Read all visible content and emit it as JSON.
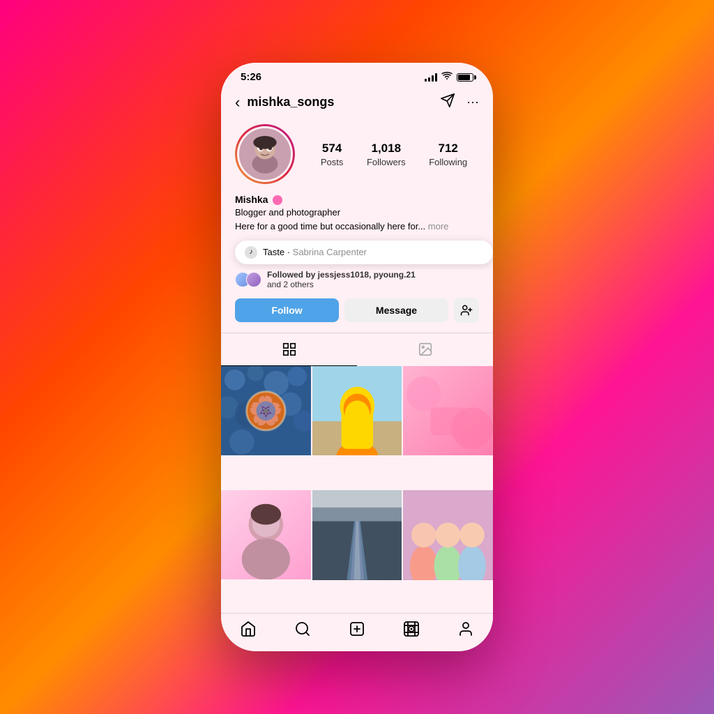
{
  "phone": {
    "status_time": "5:26",
    "background_gradient": "linear-gradient(135deg, #ff0080, #ff4500, #ff8c00, #ff1493, #9b59b6)"
  },
  "header": {
    "back_label": "‹",
    "username": "mishka_songs",
    "send_icon": "send",
    "more_icon": "more"
  },
  "profile": {
    "display_name": "Mishka",
    "verified": true,
    "bio_line1": "Blogger and photographer",
    "bio_line2": "Here for a good time but occasionally here for...",
    "bio_more": "more",
    "stats": {
      "posts_count": "574",
      "posts_label": "Posts",
      "followers_count": "1,018",
      "followers_label": "Followers",
      "following_count": "712",
      "following_label": "Following"
    }
  },
  "music": {
    "song": "Taste",
    "separator": "·",
    "artist": "Sabrina Carpenter"
  },
  "followed_by": {
    "text": "Followed by jessjess1018, pyoung.21",
    "text2": "and 2 others"
  },
  "buttons": {
    "follow": "Follow",
    "message": "Message",
    "add_friend_icon": "person-add"
  },
  "tabs": {
    "grid_icon": "grid",
    "tagged_icon": "person-tag"
  },
  "nav": {
    "home_icon": "home",
    "search_icon": "search",
    "create_icon": "plus-square",
    "reels_icon": "reels",
    "profile_icon": "person"
  }
}
